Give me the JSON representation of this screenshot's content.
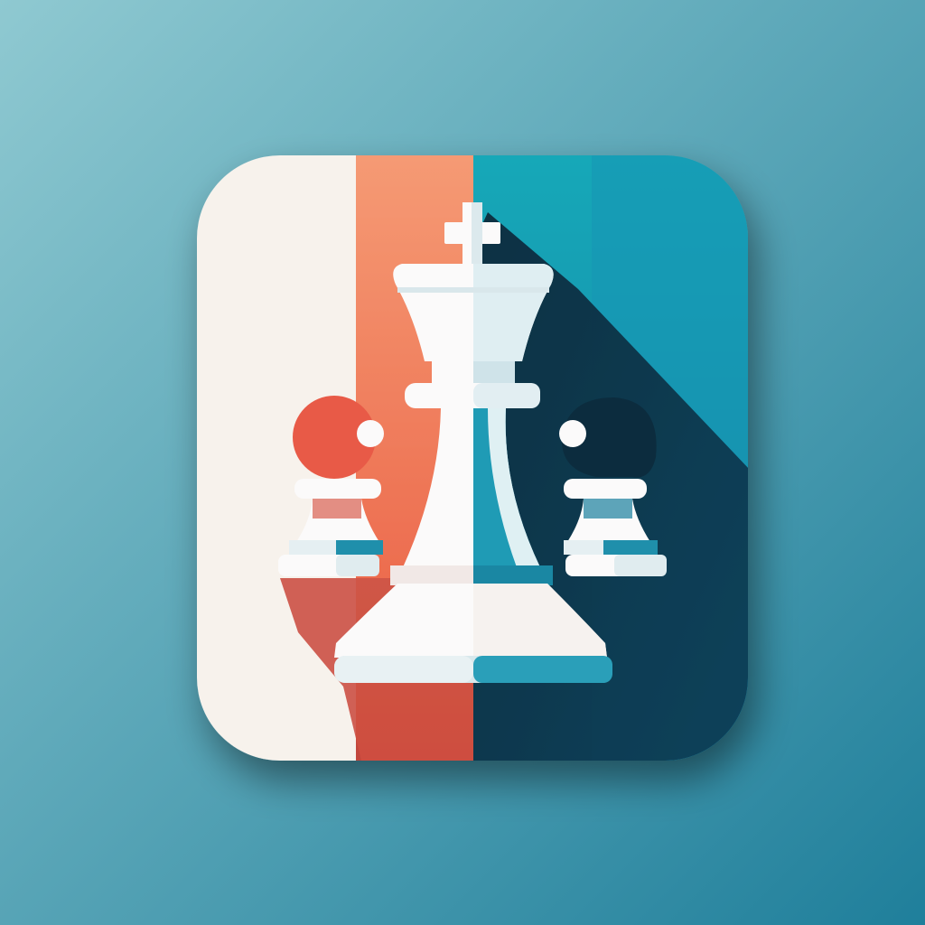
{
  "colors": {
    "background_light": "#8fc9d1",
    "background_dark": "#1f7f9b",
    "panel_white": "#f7f2ec",
    "panel_coral": "#ef7b5c",
    "panel_teal": "#17a3b5",
    "panel_teal_dark": "#138fb0",
    "shadow_dark": "#0b2a3c",
    "piece_white": "#fbfafa",
    "piece_light_blue": "#d6e6ea",
    "piece_teal": "#1f9bb5",
    "pawn_coral": "#e85a47",
    "pawn_dark": "#0c2c3e"
  },
  "icon": {
    "name": "chess-app-icon",
    "pieces": [
      "king",
      "left-pawn",
      "right-pawn"
    ]
  }
}
